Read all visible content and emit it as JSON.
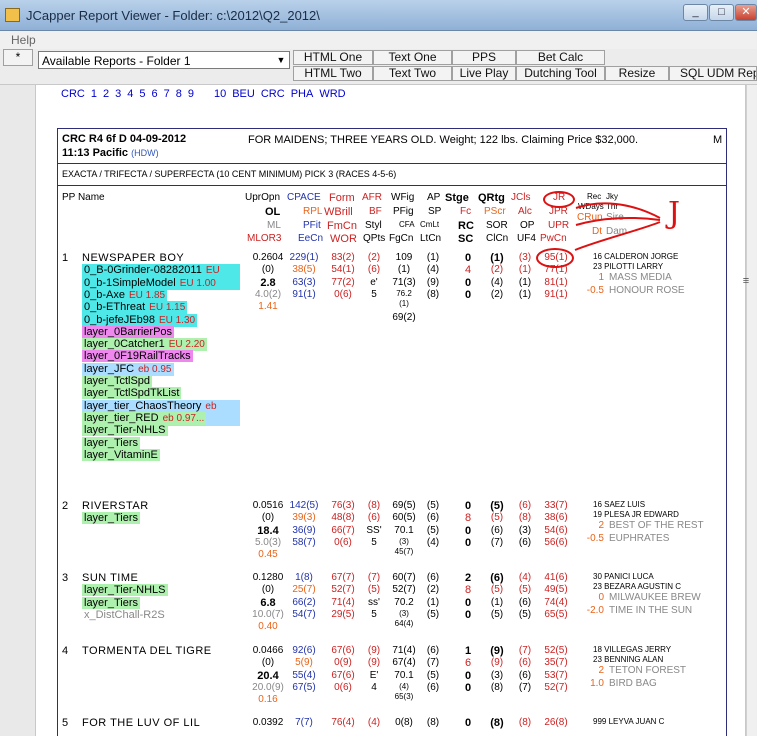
{
  "window": {
    "title": "JCapper Report Viewer - Folder: c:\\2012\\Q2_2012\\",
    "controls": [
      "_",
      "□",
      "✕"
    ]
  },
  "menu": {
    "help": "Help"
  },
  "toolbar": {
    "star": "*",
    "report_select": "Available Reports - Folder 1",
    "buttons": [
      "HTML One",
      "Text One",
      "PPS",
      "Bet Calc",
      "HTML Two",
      "Text Two",
      "Live Play",
      "Dutching Tool",
      "Resize",
      "SQL UDM Report"
    ]
  },
  "track_links": [
    "CRC",
    "1",
    "2",
    "3",
    "4",
    "5",
    "6",
    "7",
    "8",
    "9",
    "10",
    "BEU",
    "CRC",
    "PHA",
    "WRD"
  ],
  "race": {
    "header": "CRC R4 6f D 04-09-2012",
    "post_time": "11:13 Pacific",
    "hdw": "(HDW)",
    "description": "FOR MAIDENS; THREE YEARS OLD. Weight; 122 lbs. Claiming Price $32,000.",
    "corner": "M",
    "exotics": "EXACTA / TRIFECTA / SUPERFECTA (10 CENT MINIMUM) PICK 3 (RACES 4-5-6)"
  },
  "columns": {
    "pp_name": "PP Name",
    "upropn": "UprOpn",
    "ol": "OL",
    "ml": "ML",
    "mlor3": "MLOR3",
    "cpace": "CPACE",
    "rpl": "RPL",
    "pfit": "PFit",
    "eecn": "EeCn",
    "form": "Form",
    "wbrill": "WBrill",
    "fmcn": "FmCn",
    "wor": "WOR",
    "afr": "AFR",
    "bf": "BF",
    "styl": "Styl",
    "qpts": "QPts",
    "wfig": "WFig",
    "pfig": "PFig",
    "cfa": "CFA",
    "fgcn": "FgCn",
    "ap": "AP",
    "sp": "SP",
    "cmlt": "CmLt",
    "ltcn": "LtCn",
    "stge": "Stge",
    "fc": "Fc",
    "rc": "RC",
    "sc": "SC",
    "qrtg": "QRtg",
    "pscr": "PScr",
    "sor": "SOR",
    "clcn": "ClCn",
    "jcls": "JCls",
    "alc": "Alc",
    "op": "OP",
    "uf4": "UF4",
    "jr": "JR",
    "jpr": "JPR",
    "upr": "UPR",
    "pwcn": "PwCn",
    "rec": "Rec",
    "wdays": "WDays",
    "jky": "Jky",
    "tnr": "Tnr",
    "crun": "CRun",
    "sire": "Sire",
    "dt": "Dt",
    "dam": "Dam"
  },
  "annotation": {
    "letter": "J"
  },
  "horses": [
    {
      "pp": "1",
      "name": "NEWSPAPER BOY",
      "c1": [
        "0.2604",
        "(0)",
        "2.8",
        "4.0(2)",
        "1.41"
      ],
      "c2": [
        "229(1)",
        "38(5)",
        "63(3)",
        "91(1)"
      ],
      "c3": [
        "83(2)",
        "54(1)",
        "77(2)",
        "0(6)"
      ],
      "c4": [
        "(2)",
        "(6)",
        "e'",
        "5"
      ],
      "c5": [
        "109",
        "(1)",
        "71(3)",
        "76.2",
        "(1)",
        "69(2)"
      ],
      "c6": [
        "(1)",
        "(4)",
        "(9)",
        "(8)"
      ],
      "c7": [
        "0",
        "4",
        "0",
        "0"
      ],
      "c8": [
        "(1)",
        "(2)",
        "(4)",
        "(2)"
      ],
      "c9": [
        "(3)",
        "(1)",
        "(1)",
        "(1)"
      ],
      "c10": [
        "95(1)",
        "77(1)",
        "81(1)",
        "91(1)"
      ],
      "jky": [
        "16 CALDERON JORGE",
        "23 PILOTTI LARRY"
      ],
      "sire": [
        [
          "1",
          "MASS MEDIA"
        ],
        [
          "-0.5",
          "HONOUR ROSE"
        ]
      ],
      "tags": [
        [
          "0_B-0Grinder-08282011",
          "EU 1.20",
          "#4ee8e8"
        ],
        [
          "0_b-1SimpleModel",
          "EU 1.00",
          "#4ee8e8"
        ],
        [
          "0_b-Axe",
          "EU 1.85",
          "#4ee8e8"
        ],
        [
          "0_b-EThreat",
          "EU 1.15",
          "#4ee8e8"
        ],
        [
          "0_b-jefeJEb98",
          "EU 1.30",
          "#4ee8e8"
        ],
        [
          "layer_0BarrierPos",
          "",
          "#ee88ee"
        ],
        [
          "layer_0Catcher1",
          "EU 2.20",
          "#aef0ae"
        ],
        [
          "layer_0F19RailTracks",
          "",
          "#ee88ee"
        ],
        [
          "layer_JFC",
          "eb 0.95",
          "#aaddff"
        ],
        [
          "layer_TctlSpd",
          "",
          "#aef0ae"
        ],
        [
          "layer_TctlSpdTkList",
          "",
          "#aef0ae"
        ],
        [
          "layer_tier_ChaosTheory",
          "eb 0.85... 9-2...",
          "#aaddff"
        ],
        [
          "layer_tier_RED",
          "eb 0.97...",
          "#aef0ae"
        ],
        [
          "layer_Tier-NHLS",
          "",
          "#aef0ae"
        ],
        [
          "layer_Tiers",
          "",
          "#aef0ae"
        ],
        [
          "layer_VitaminE",
          "",
          "#aef0ae"
        ]
      ]
    },
    {
      "pp": "2",
      "name": "RIVERSTAR",
      "c1": [
        "0.0516",
        "(0)",
        "18.4",
        "5.0(3)",
        "0.45"
      ],
      "c2": [
        "142(5)",
        "39(3)",
        "36(9)",
        "58(7)"
      ],
      "c3": [
        "76(3)",
        "48(8)",
        "66(7)",
        "0(6)"
      ],
      "c4": [
        "(8)",
        "(6)",
        "SS'",
        "5"
      ],
      "c5": [
        "69(5)",
        "60(5)",
        "70.1",
        "(3)",
        "45(7)"
      ],
      "c6": [
        "(5)",
        "(6)",
        "(5)",
        "(4)"
      ],
      "c7": [
        "0",
        "8",
        "0",
        "0"
      ],
      "c8": [
        "(5)",
        "(5)",
        "(6)",
        "(7)"
      ],
      "c9": [
        "(6)",
        "(8)",
        "(3)",
        "(6)"
      ],
      "c10": [
        "33(7)",
        "38(6)",
        "54(6)",
        "56(6)"
      ],
      "jky": [
        "16 SAEZ LUIS",
        "19 PLESA JR EDWARD"
      ],
      "sire": [
        [
          "2",
          "BEST OF THE REST"
        ],
        [
          "-0.5",
          "EUPHRATES"
        ]
      ],
      "tags": [
        [
          "layer_Tiers",
          "",
          "#aef0ae"
        ]
      ]
    },
    {
      "pp": "3",
      "name": "SUN TIME",
      "c1": [
        "0.1280",
        "(0)",
        "6.8",
        "10.0(7)",
        "0.40"
      ],
      "c2": [
        "1(8)",
        "25(7)",
        "66(2)",
        "54(7)"
      ],
      "c3": [
        "67(7)",
        "52(7)",
        "71(4)",
        "29(5)"
      ],
      "c4": [
        "(7)",
        "(5)",
        "ss'",
        "5"
      ],
      "c5": [
        "60(7)",
        "52(7)",
        "70.2",
        "(3)",
        "64(4)"
      ],
      "c6": [
        "(6)",
        "(2)",
        "(1)",
        "(5)"
      ],
      "c7": [
        "2",
        "8",
        "0",
        "0"
      ],
      "c8": [
        "(6)",
        "(5)",
        "(1)",
        "(5)"
      ],
      "c9": [
        "(4)",
        "(5)",
        "(6)",
        "(5)"
      ],
      "c10": [
        "41(6)",
        "49(5)",
        "74(4)",
        "65(5)"
      ],
      "jky": [
        "30 PANICI LUCA",
        "23 BEZARA AGUSTIN C"
      ],
      "sire": [
        [
          "0",
          "MILWAUKEE BREW"
        ],
        [
          "-2.0",
          "TIME IN THE SUN"
        ]
      ],
      "tags": [
        [
          "layer_Tier-NHLS",
          "",
          "#aef0ae"
        ],
        [
          "layer_Tiers",
          "",
          "#aef0ae"
        ],
        [
          "x_DistChall-R2S",
          "",
          "transparent"
        ]
      ]
    },
    {
      "pp": "4",
      "name": "TORMENTA DEL TIGRE",
      "c1": [
        "0.0466",
        "(0)",
        "20.4",
        "20.0(9)",
        "0.16"
      ],
      "c2": [
        "92(6)",
        "5(9)",
        "55(4)",
        "67(5)"
      ],
      "c3": [
        "67(6)",
        "0(9)",
        "67(6)",
        "0(6)"
      ],
      "c4": [
        "(9)",
        "(9)",
        "E'",
        "4"
      ],
      "c5": [
        "71(4)",
        "67(4)",
        "70.1",
        "(4)",
        "65(3)"
      ],
      "c6": [
        "(6)",
        "(7)",
        "(5)",
        "(6)"
      ],
      "c7": [
        "1",
        "6",
        "0",
        "0"
      ],
      "c8": [
        "(9)",
        "(9)",
        "(3)",
        "(8)"
      ],
      "c9": [
        "(7)",
        "(6)",
        "(6)",
        "(7)"
      ],
      "c10": [
        "52(5)",
        "35(7)",
        "53(7)",
        "52(7)"
      ],
      "jky": [
        "18 VILLEGAS JERRY",
        "23 BENNING ALAN"
      ],
      "sire": [
        [
          "2",
          "TETON FOREST"
        ],
        [
          "1.0",
          "BIRD BAG"
        ]
      ],
      "tags": []
    },
    {
      "pp": "5",
      "name": "FOR THE LUV OF LIL",
      "c1": [
        "0.0392"
      ],
      "c2": [
        "7(7)"
      ],
      "c3": [
        "76(4)"
      ],
      "c4": [
        "(4)"
      ],
      "c5": [
        "0(8)"
      ],
      "c6": [
        "(8)"
      ],
      "c7": [
        "0"
      ],
      "c8": [
        "(8)"
      ],
      "c9": [
        "(8)"
      ],
      "c10": [
        "26(8)"
      ],
      "jky": [
        "999 LEYVA JUAN C"
      ],
      "sire": [],
      "tags": []
    }
  ]
}
